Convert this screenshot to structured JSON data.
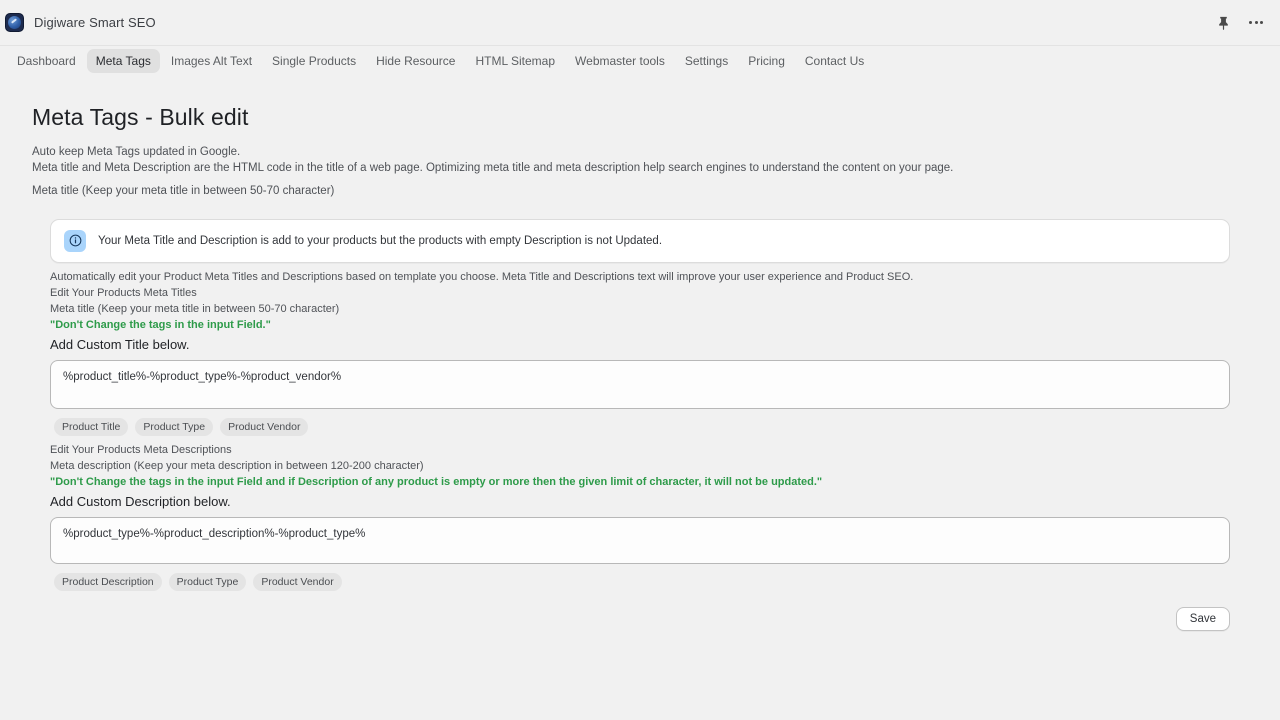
{
  "titlebar": {
    "app_name": "Digiware Smart SEO",
    "logo_icon": "app-logo-icon",
    "pin_icon": "pin-icon",
    "more_icon": "more-horizontal-icon"
  },
  "nav": {
    "items": [
      {
        "label": "Dashboard",
        "active": false
      },
      {
        "label": "Meta Tags",
        "active": true
      },
      {
        "label": "Images Alt Text",
        "active": false
      },
      {
        "label": "Single Products",
        "active": false
      },
      {
        "label": "Hide Resource",
        "active": false
      },
      {
        "label": "HTML Sitemap",
        "active": false
      },
      {
        "label": "Webmaster tools",
        "active": false
      },
      {
        "label": "Settings",
        "active": false
      },
      {
        "label": "Pricing",
        "active": false
      },
      {
        "label": "Contact Us",
        "active": false
      }
    ]
  },
  "page": {
    "title": "Meta Tags - Bulk edit",
    "lead_line_1": "Auto keep Meta Tags updated in Google.",
    "lead_line_2": "Meta title and Meta Description are the HTML code in the title of a web page. Optimizing meta title and meta description help search engines to understand the content on your page.",
    "lead_line_3": "Meta title (Keep your meta title in between 50-70 character)"
  },
  "banner": {
    "icon": "info-circle-icon",
    "text": "Your Meta Title and Description is add to your products but the products with empty Description is not Updated.",
    "icon_bg_color": "#a9d4fb"
  },
  "intro": {
    "description": "Automatically edit your Product Meta Titles and Descriptions based on template you choose. Meta Title and Descriptions text will improve your user experience and Product SEO."
  },
  "title_section": {
    "heading": "Edit Your Products Meta Titles",
    "hint": "Meta title (Keep your meta title in between 50-70 character)",
    "warning": "\"Don't Change the tags in the input Field.\"",
    "warning_color": "#2e9b4a",
    "label": "Add Custom Title below.",
    "textarea_value": "%product_title%-%product_type%-%product_vendor%",
    "textarea_placeholder": "Add Custom Title below.",
    "chips": [
      "Product Title",
      "Product Type",
      "Product Vendor"
    ]
  },
  "description_section": {
    "heading": "Edit Your Products Meta Descriptions",
    "hint": "Meta description (Keep your meta description in between 120-200 character)",
    "warning": "\"Don't Change the tags in the input Field and if Description of any product is empty or more then the given limit of character, it will not be updated.\"",
    "warning_color": "#2e9b4a",
    "label": "Add Custom Description below.",
    "textarea_value": "%product_type%-%product_description%-%product_type%",
    "textarea_placeholder": "Add Custom Description below.",
    "chips": [
      "Product Description",
      "Product Type",
      "Product Vendor"
    ]
  },
  "footer": {
    "save_label": "Save"
  }
}
